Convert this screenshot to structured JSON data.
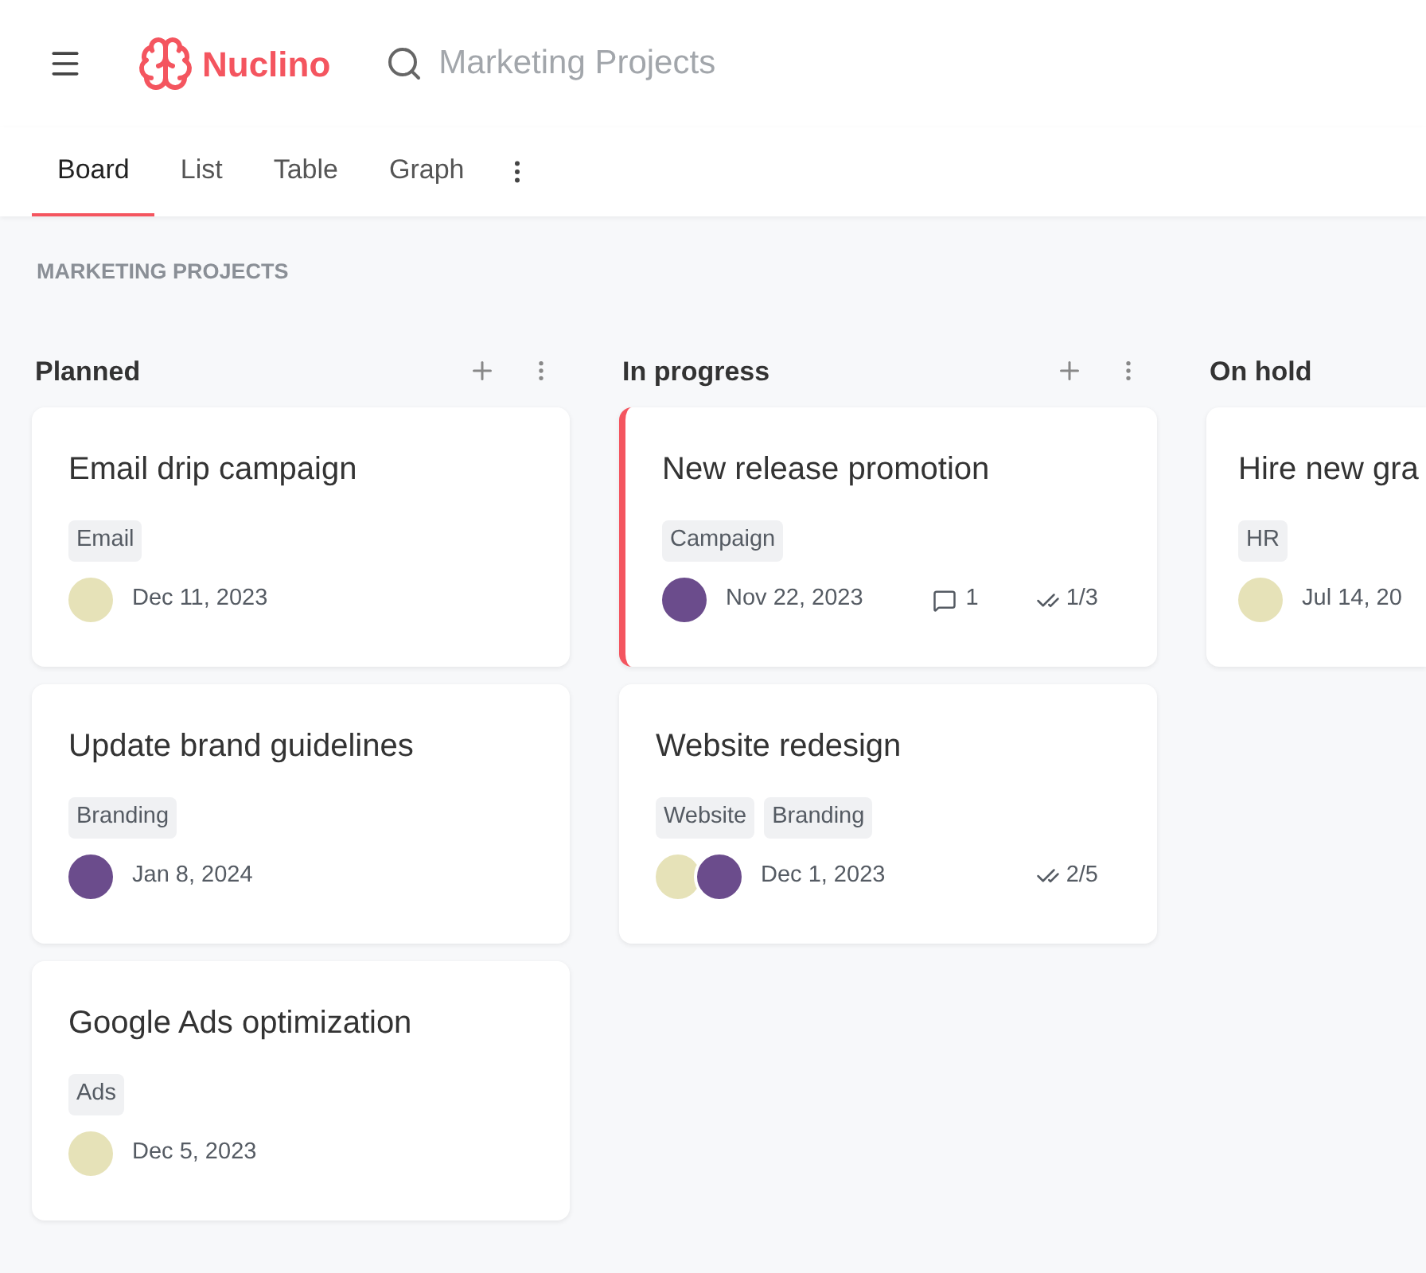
{
  "header": {
    "logo": "Nuclino",
    "search": {
      "placeholder": "Marketing Projects"
    }
  },
  "tabs": [
    {
      "label": "Board",
      "selected": true
    },
    {
      "label": "List",
      "selected": false
    },
    {
      "label": "Table",
      "selected": false
    },
    {
      "label": "Graph",
      "selected": false
    }
  ],
  "board": {
    "title": "MARKETING PROJECTS",
    "columns": [
      {
        "name": "Planned",
        "actions": true,
        "cards": [
          {
            "title": "Email drip campaign",
            "selected": false,
            "tags": [
              "Email"
            ],
            "avatars": [
              {
                "color": "#e6e2b8"
              }
            ],
            "date": "Dec 11, 2023"
          },
          {
            "title": "Update brand guidelines",
            "selected": false,
            "tags": [
              "Branding"
            ],
            "avatars": [
              {
                "color": "#6b4c8c"
              }
            ],
            "date": "Jan 8, 2024"
          },
          {
            "title": "Google Ads optimization",
            "selected": false,
            "tags": [
              "Ads"
            ],
            "avatars": [
              {
                "color": "#e6e2b8"
              }
            ],
            "date": "Dec 5, 2023"
          }
        ]
      },
      {
        "name": "In progress",
        "actions": true,
        "cards": [
          {
            "title": "New release promotion",
            "selected": true,
            "tags": [
              "Campaign"
            ],
            "avatars": [
              {
                "color": "#6b4c8c"
              }
            ],
            "date": "Nov 22, 2023",
            "comments": "1",
            "checklist": "1/3"
          },
          {
            "title": "Website redesign",
            "selected": false,
            "tags": [
              "Website",
              "Branding"
            ],
            "avatars": [
              {
                "color": "#e6e2b8"
              },
              {
                "color": "#6b4c8c"
              }
            ],
            "date": "Dec 1, 2023",
            "checklist": "2/5"
          }
        ]
      },
      {
        "name": "On hold",
        "actions": false,
        "cards": [
          {
            "title": "Hire new gra",
            "selected": false,
            "tags": [
              "HR"
            ],
            "avatars": [
              {
                "color": "#e6e2b8"
              }
            ],
            "date": "Jul 14, 20"
          }
        ]
      }
    ]
  }
}
